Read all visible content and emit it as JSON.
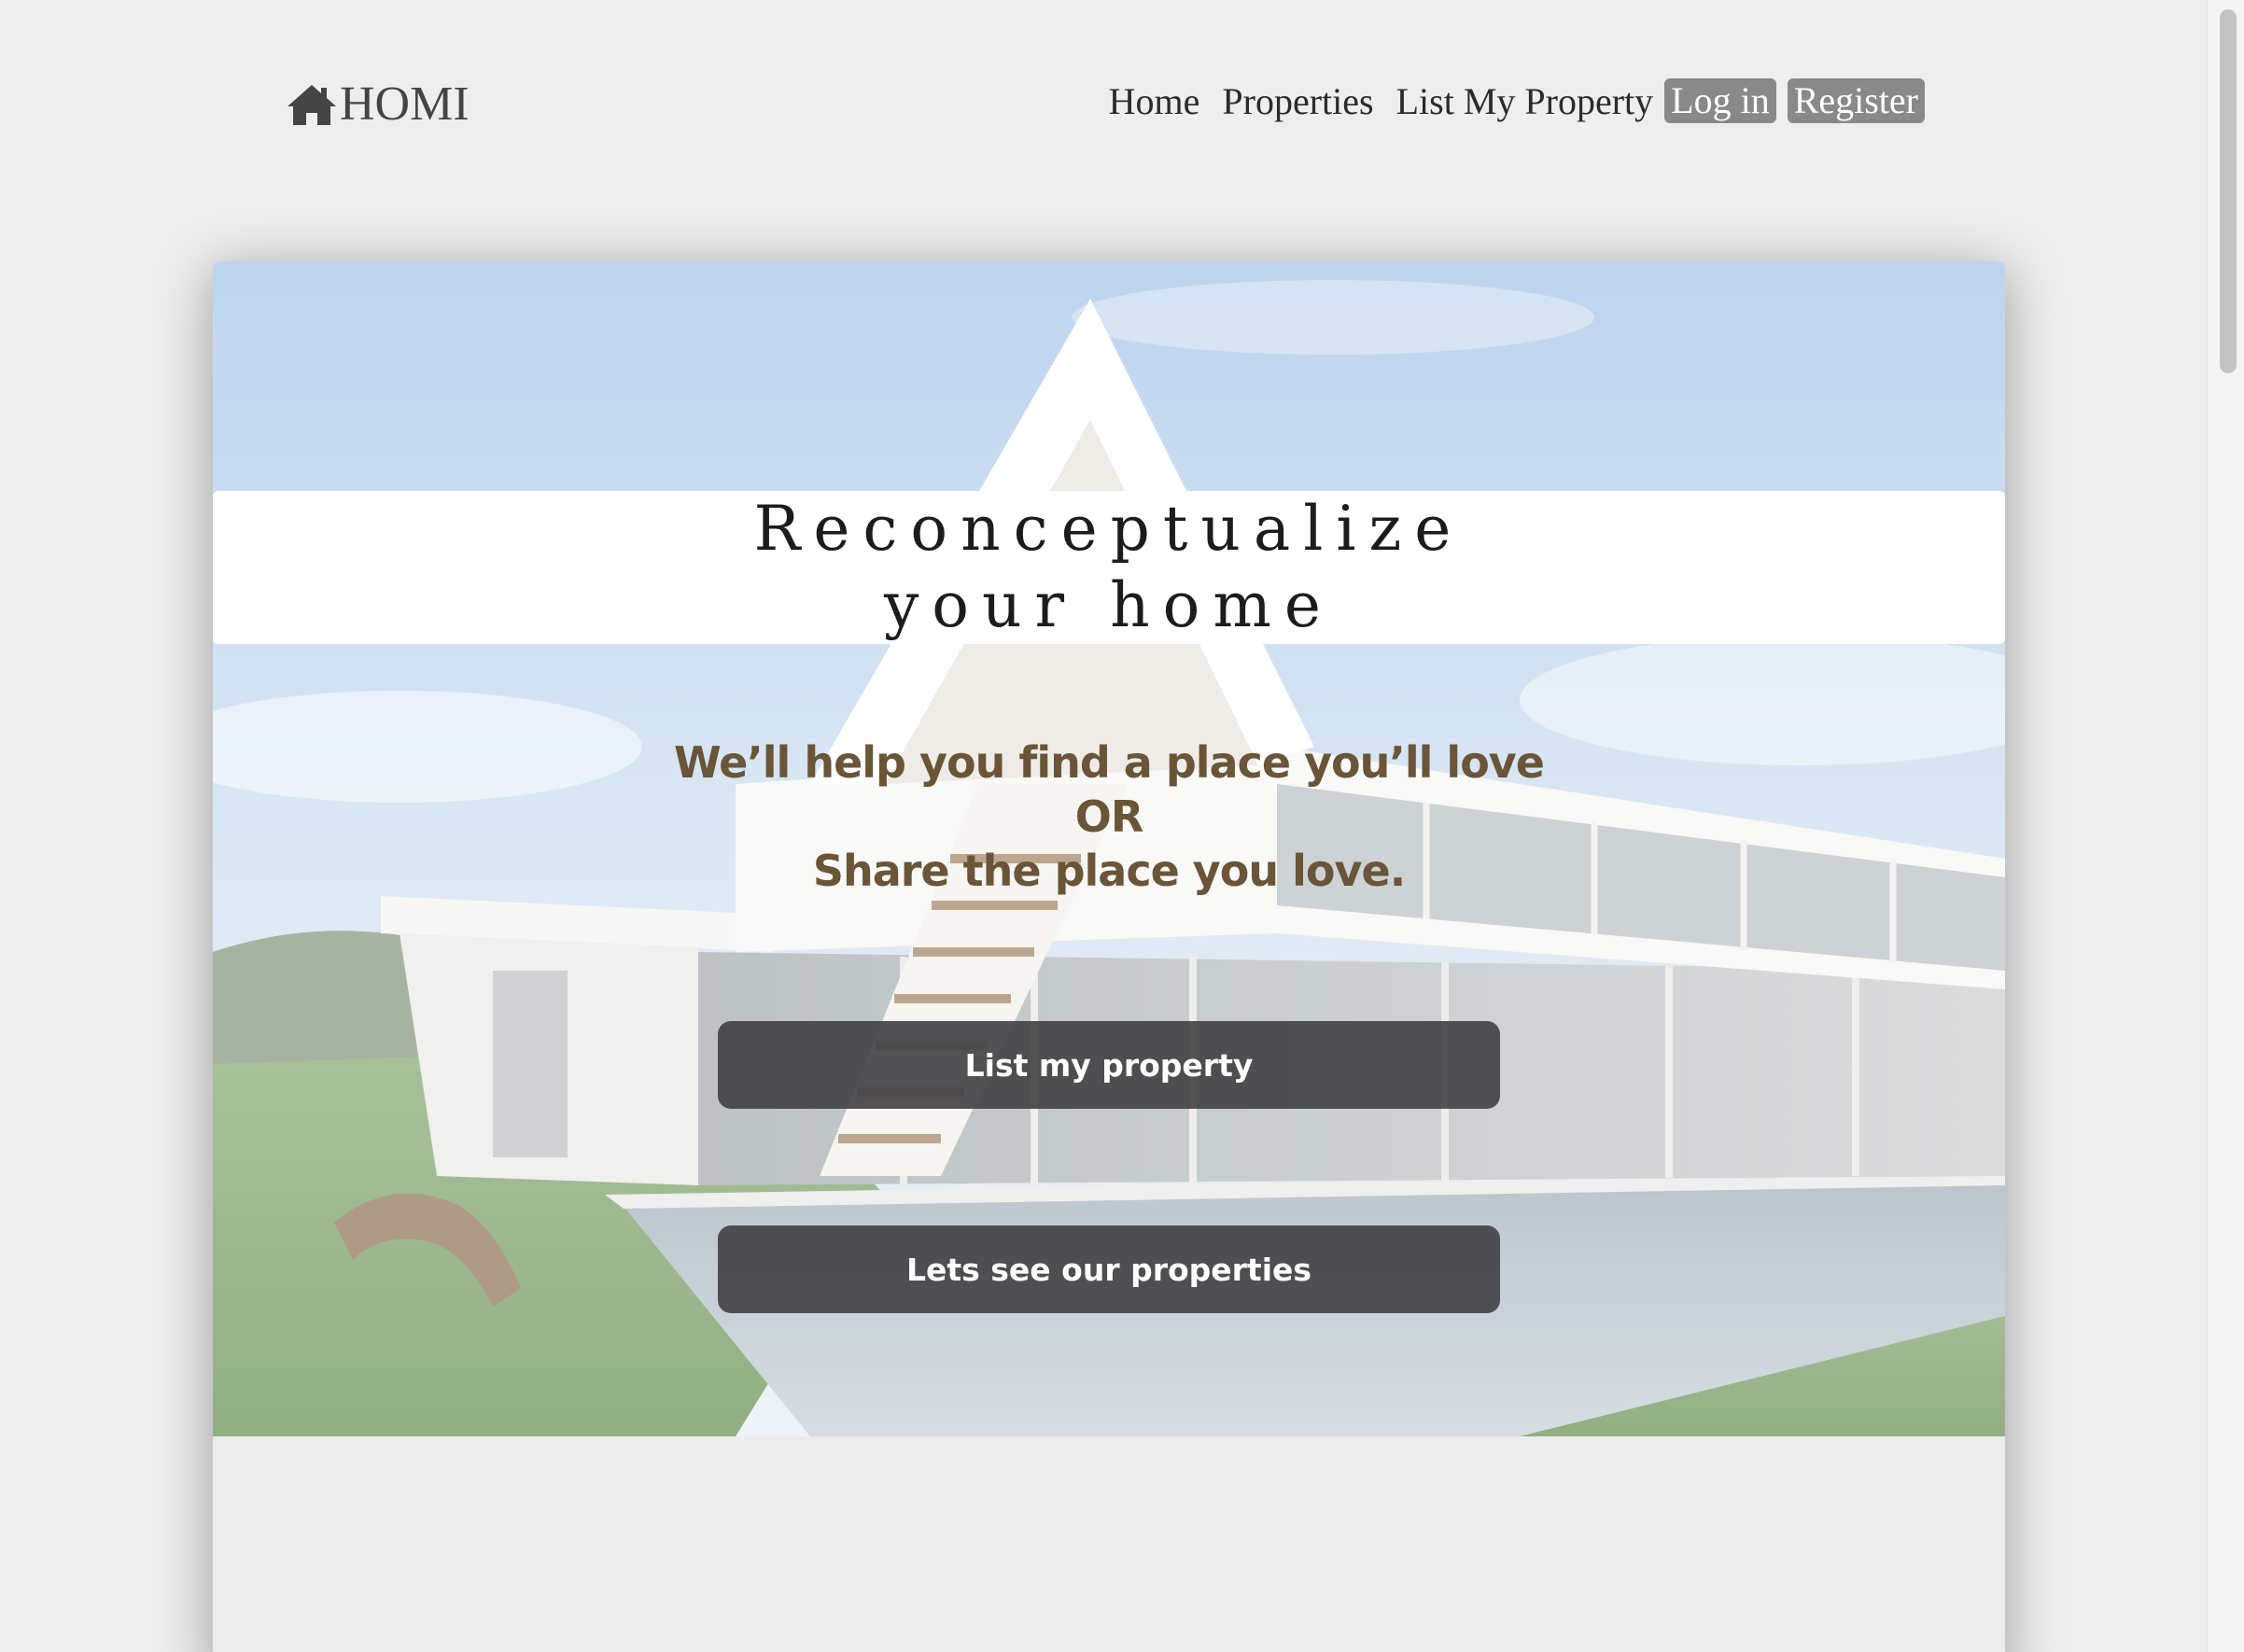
{
  "brand": {
    "name": "HOMI",
    "icon": "house-icon"
  },
  "nav": {
    "items": [
      {
        "label": "Home"
      },
      {
        "label": "Properties"
      },
      {
        "label": "List My Property"
      }
    ],
    "login": "Log in",
    "register": "Register"
  },
  "hero": {
    "title_line1": "Reconceptualize",
    "title_line2": "your home",
    "tagline_line1": "We’ll help you find a place you’ll love",
    "tagline_line2": "OR",
    "tagline_line3": "Share the place you love.",
    "primary_button": "List my property",
    "secondary_button": "Lets see our properties"
  },
  "colors": {
    "page_background": "#eeeeee",
    "tagline": "#6a5538",
    "button_background": "#404042",
    "auth_pill": "#898989"
  }
}
